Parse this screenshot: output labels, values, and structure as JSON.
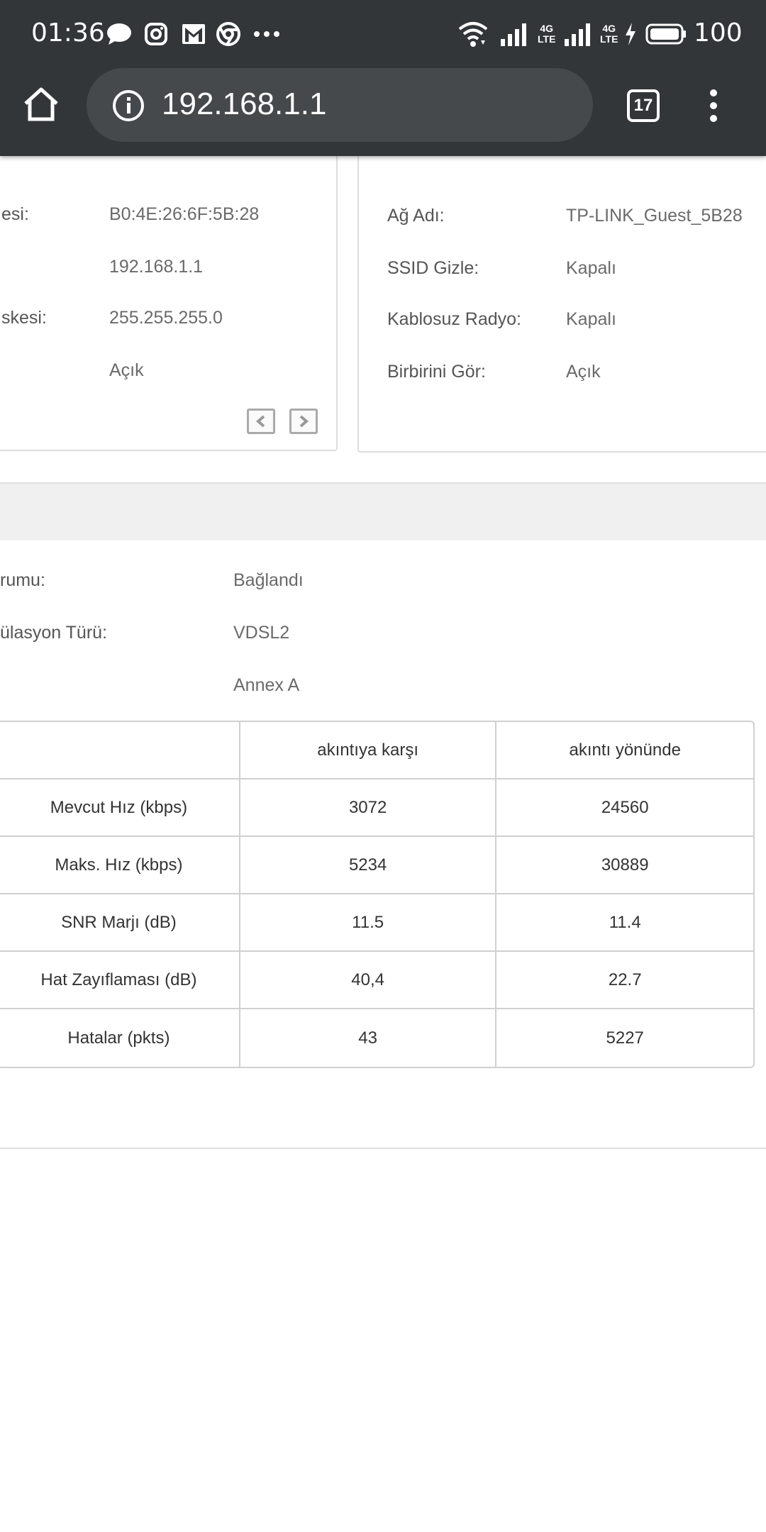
{
  "status_bar": {
    "time": "01:36",
    "battery": "100",
    "notification_icons": [
      "chat-bubble-icon",
      "instagram-icon",
      "gmail-icon",
      "chrome-icon",
      "more-dots-icon"
    ],
    "network_labels": [
      "4G",
      "LTE",
      "4G",
      "LTE"
    ]
  },
  "browser": {
    "url": "192.168.1.1",
    "tab_count": "17"
  },
  "left_panel": {
    "rows": [
      {
        "label": "esi:",
        "value": "B0:4E:26:6F:5B:28"
      },
      {
        "label": "",
        "value": "192.168.1.1"
      },
      {
        "label": "skesi:",
        "value": "255.255.255.0"
      },
      {
        "label": "",
        "value": "Açık"
      }
    ]
  },
  "right_panel": {
    "rows": [
      {
        "label": "Ağ Adı:",
        "value": "TP-LINK_Guest_5B28"
      },
      {
        "label": "SSID Gizle:",
        "value": "Kapalı"
      },
      {
        "label": "Kablosuz Radyo:",
        "value": "Kapalı"
      },
      {
        "label": "Birbirini Gör:",
        "value": "Açık"
      }
    ]
  },
  "dsl": {
    "rows": [
      {
        "label": "rumu:",
        "value": "Bağlandı"
      },
      {
        "label": "ülasyon Türü:",
        "value": "VDSL2"
      },
      {
        "label": "",
        "value": "Annex A"
      }
    ]
  },
  "stats_table": {
    "headers": [
      "",
      "akıntıya karşı",
      "akıntı yönünde"
    ],
    "rows": [
      [
        "Mevcut Hız (kbps)",
        "3072",
        "24560"
      ],
      [
        "Maks. Hız (kbps)",
        "5234",
        "30889"
      ],
      [
        "SNR Marjı (dB)",
        "11.5",
        "11.4"
      ],
      [
        "Hat Zayıflaması (dB)",
        "40,4",
        "22.7"
      ],
      [
        "Hatalar (pkts)",
        "43",
        "5227"
      ]
    ]
  }
}
